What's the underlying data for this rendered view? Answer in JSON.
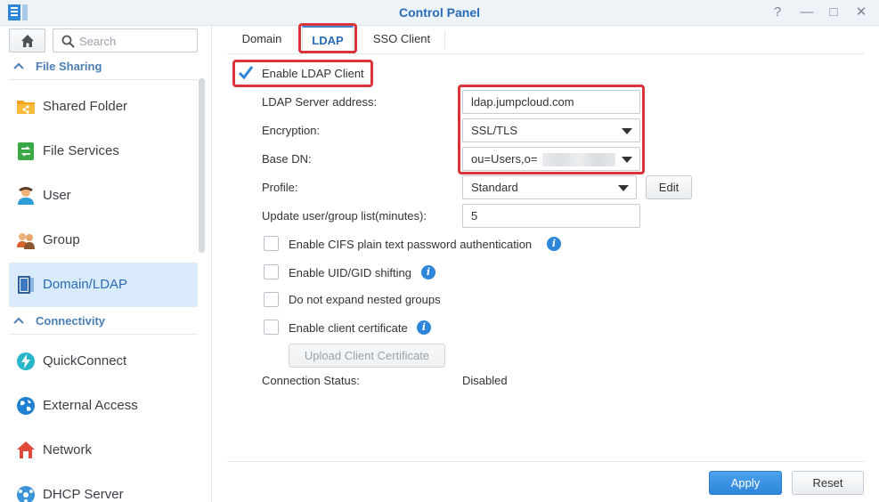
{
  "window": {
    "title": "Control Panel"
  },
  "sidebar": {
    "search_placeholder": "Search",
    "sections": [
      {
        "label": "File Sharing"
      },
      {
        "label": "Connectivity"
      }
    ],
    "items": [
      {
        "label": "Shared Folder",
        "icon": "shared-folder-icon"
      },
      {
        "label": "File Services",
        "icon": "file-services-icon"
      },
      {
        "label": "User",
        "icon": "user-icon"
      },
      {
        "label": "Group",
        "icon": "group-icon"
      },
      {
        "label": "Domain/LDAP",
        "icon": "domain-ldap-icon",
        "active": true
      },
      {
        "label": "QuickConnect",
        "icon": "quickconnect-icon"
      },
      {
        "label": "External Access",
        "icon": "globe-icon"
      },
      {
        "label": "Network",
        "icon": "network-icon"
      },
      {
        "label": "DHCP Server",
        "icon": "dhcp-server-icon"
      }
    ]
  },
  "tabs": [
    {
      "label": "Domain"
    },
    {
      "label": "LDAP",
      "active": true
    },
    {
      "label": "SSO Client"
    }
  ],
  "ldap": {
    "enable_label": "Enable LDAP Client",
    "enable_checked": true,
    "server_label": "LDAP Server address:",
    "server_value": "ldap.jumpcloud.com",
    "encryption_label": "Encryption:",
    "encryption_value": "SSL/TLS",
    "basedn_label": "Base DN:",
    "basedn_value": "ou=Users,o=",
    "profile_label": "Profile:",
    "profile_value": "Standard",
    "edit_label": "Edit",
    "update_label": "Update user/group list(minutes):",
    "update_value": "5",
    "options": [
      {
        "label": "Enable CIFS plain text password authentication",
        "checked": false,
        "info": true
      },
      {
        "label": "Enable UID/GID shifting",
        "checked": false,
        "info": true
      },
      {
        "label": "Do not expand nested groups",
        "checked": false,
        "info": false
      },
      {
        "label": "Enable client certificate",
        "checked": false,
        "info": true
      }
    ],
    "upload_label": "Upload Client Certificate",
    "status_label": "Connection Status:",
    "status_value": "Disabled"
  },
  "footer": {
    "apply_label": "Apply",
    "reset_label": "Reset"
  },
  "colors": {
    "accent": "#2a6bb6",
    "highlight": "#d9343a",
    "primary_button": "#2d86da"
  }
}
